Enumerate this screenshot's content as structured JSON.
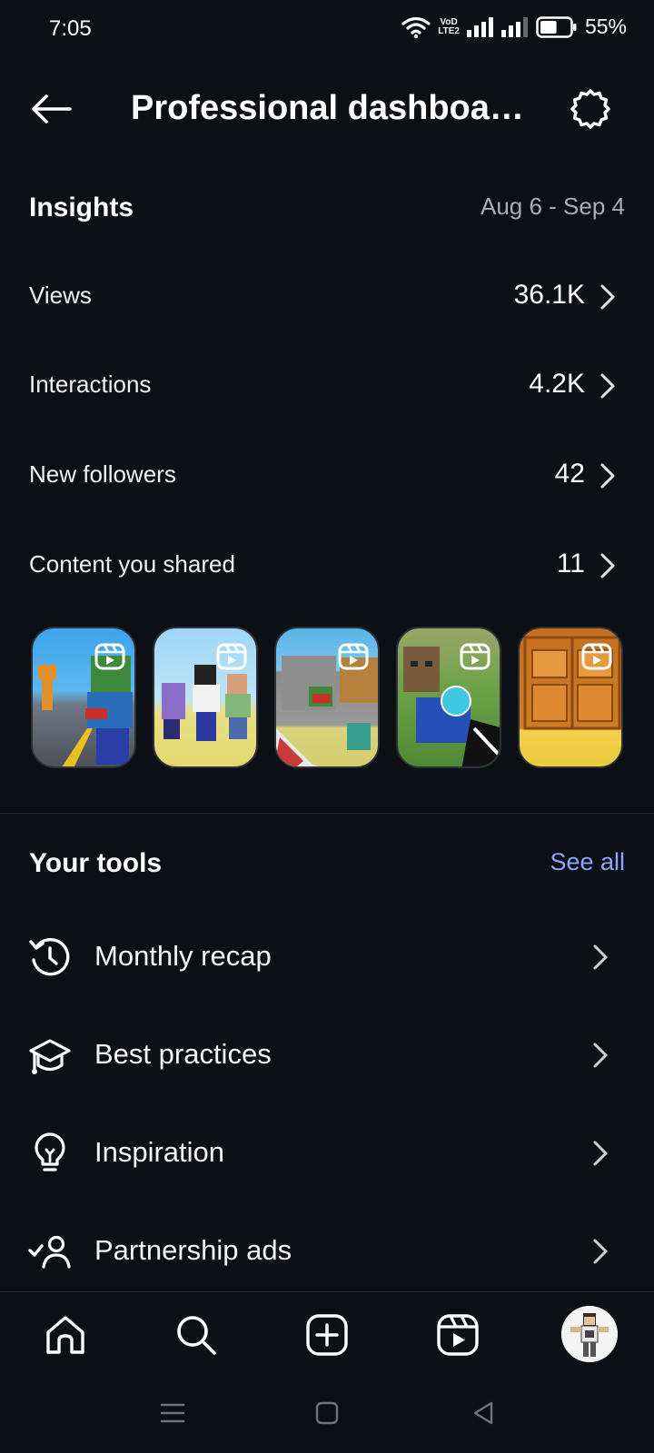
{
  "status": {
    "time": "7:05",
    "battery": "55%",
    "volte_top": "VoD",
    "volte_bottom": "LTE2",
    "battery_level": 0.55
  },
  "header": {
    "title": "Professional dashboa…",
    "back_icon": "arrow-left-icon",
    "settings_icon": "gear-icon"
  },
  "insights": {
    "title": "Insights",
    "date_range": "Aug 6 - Sep 4",
    "metrics": [
      {
        "label": "Views",
        "value": "36.1K"
      },
      {
        "label": "Interactions",
        "value": "4.2K"
      },
      {
        "label": "New followers",
        "value": "42"
      },
      {
        "label": "Content you shared",
        "value": "11"
      }
    ],
    "thumbnails": [
      {
        "icon": "reels-icon",
        "theme": "#3a9be0"
      },
      {
        "icon": "reels-icon",
        "theme": "#8fd0f5"
      },
      {
        "icon": "reels-icon",
        "theme": "#5fb6e8"
      },
      {
        "icon": "reels-icon",
        "theme": "#6fa34a"
      },
      {
        "icon": "reels-icon",
        "theme": "#c8731e"
      }
    ]
  },
  "tools": {
    "title": "Your tools",
    "see_all": "See all",
    "items": [
      {
        "label": "Monthly recap",
        "icon": "history-icon"
      },
      {
        "label": "Best practices",
        "icon": "graduation-cap-icon"
      },
      {
        "label": "Inspiration",
        "icon": "lightbulb-icon"
      },
      {
        "label": "Partnership ads",
        "icon": "partnership-icon"
      }
    ]
  },
  "bottom_nav": [
    "home-icon",
    "search-icon",
    "create-icon",
    "reels-icon",
    "profile-avatar"
  ],
  "system_nav": [
    "menu-icon",
    "home-square-icon",
    "back-triangle-icon"
  ],
  "colors": {
    "background": "#0c0f14",
    "accent_link": "#8fa4ff",
    "secondary_text": "#a8adb6"
  }
}
